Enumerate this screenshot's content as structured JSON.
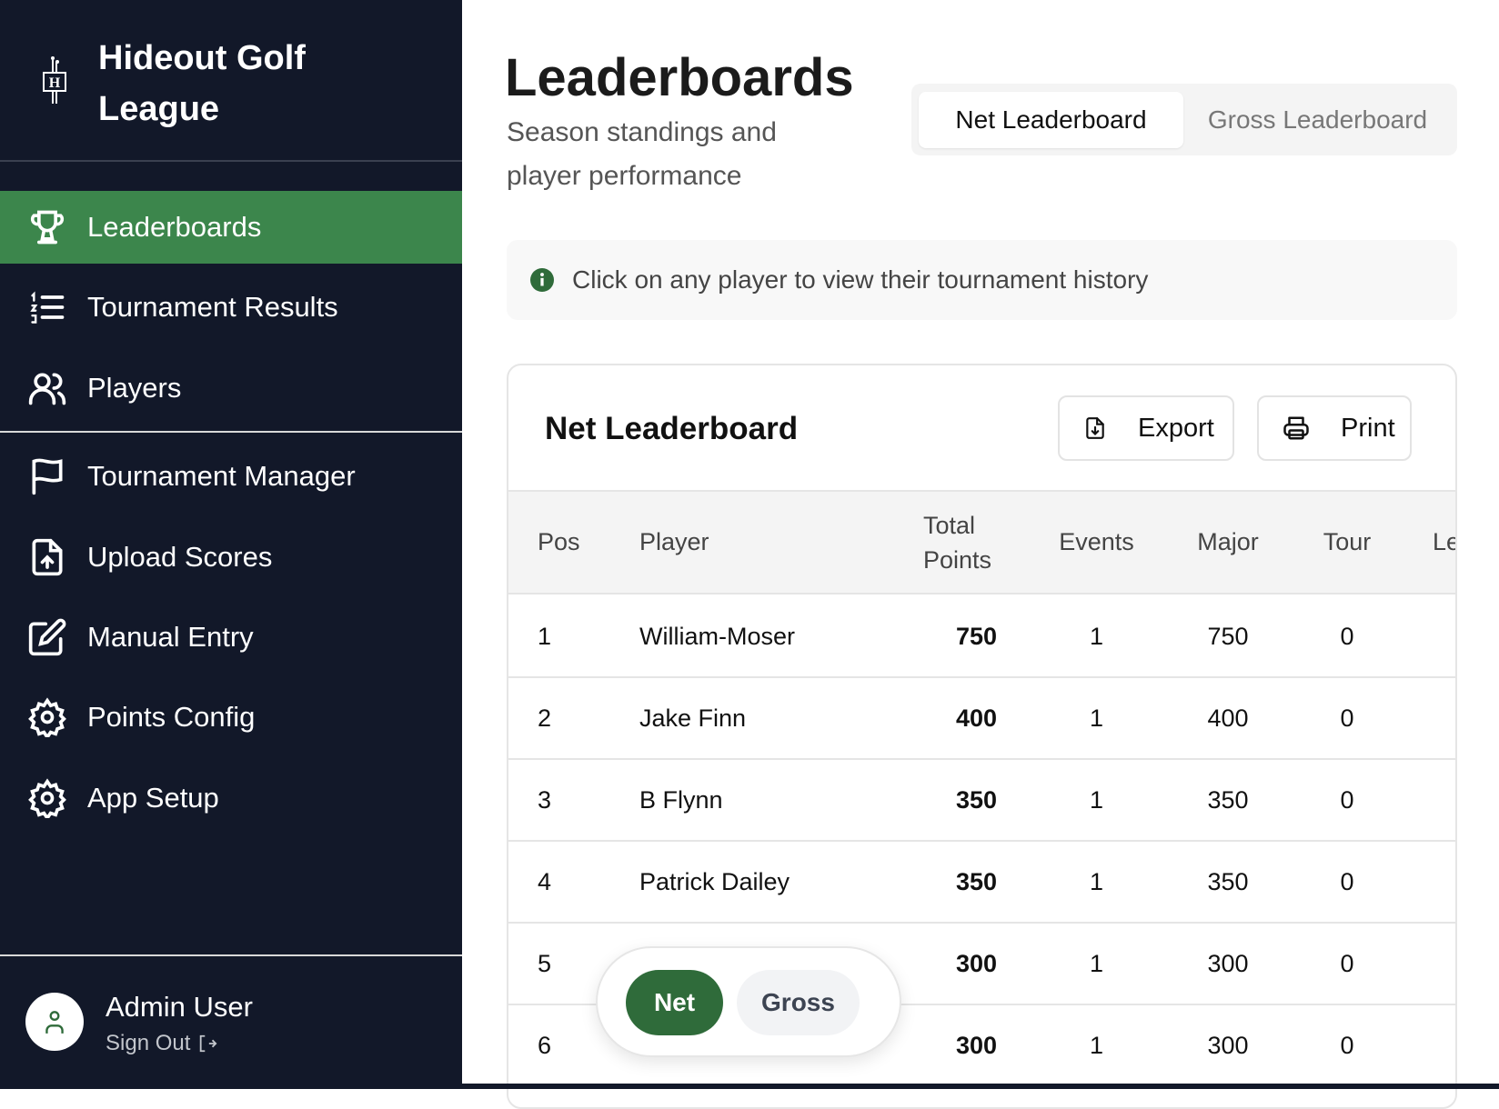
{
  "sidebar": {
    "brand": {
      "line1": "Hideout Golf",
      "line2": "League",
      "logo_text": "H"
    },
    "items": [
      {
        "label": "Leaderboards",
        "icon": "trophy-icon",
        "active": true
      },
      {
        "label": "Tournament Results",
        "icon": "numbered-list-icon"
      },
      {
        "label": "Players",
        "icon": "users-icon"
      },
      {
        "label": "Tournament Manager",
        "icon": "flag-icon"
      },
      {
        "label": "Upload Scores",
        "icon": "file-upload-icon"
      },
      {
        "label": "Manual Entry",
        "icon": "edit-icon"
      },
      {
        "label": "Points Config",
        "icon": "gear-icon"
      },
      {
        "label": "App Setup",
        "icon": "gear-icon"
      }
    ],
    "user": {
      "name": "Admin User",
      "sign_out": "Sign Out"
    }
  },
  "header": {
    "title": "Leaderboards",
    "subtitle": "Season standings and player performance"
  },
  "tabs": [
    {
      "label": "Net Leaderboard",
      "active": true
    },
    {
      "label": "Gross Leaderboard",
      "active": false
    }
  ],
  "info": {
    "text": "Click on any player to view their tournament history"
  },
  "card": {
    "title": "Net Leaderboard",
    "export_label": "Export",
    "print_label": "Print"
  },
  "table": {
    "columns": [
      "Pos",
      "Player",
      "Total Points",
      "Events",
      "Major",
      "Tour",
      "Le"
    ],
    "rows": [
      {
        "pos": "1",
        "player": "William-Moser",
        "total": "750",
        "events": "1",
        "major": "750",
        "tour": "0"
      },
      {
        "pos": "2",
        "player": "Jake Finn",
        "total": "400",
        "events": "1",
        "major": "400",
        "tour": "0"
      },
      {
        "pos": "3",
        "player": "B Flynn",
        "total": "350",
        "events": "1",
        "major": "350",
        "tour": "0"
      },
      {
        "pos": "4",
        "player": "Patrick Dailey",
        "total": "350",
        "events": "1",
        "major": "350",
        "tour": "0"
      },
      {
        "pos": "5",
        "player": "",
        "total": "300",
        "events": "1",
        "major": "300",
        "tour": "0"
      },
      {
        "pos": "6",
        "player": "",
        "total": "300",
        "events": "1",
        "major": "300",
        "tour": "0"
      }
    ]
  },
  "toggle": {
    "net": "Net",
    "gross": "Gross",
    "active": "Net"
  },
  "colors": {
    "sidebar_bg": "#121829",
    "accent": "#3c864c",
    "toggle_active": "#2f6b3a"
  }
}
